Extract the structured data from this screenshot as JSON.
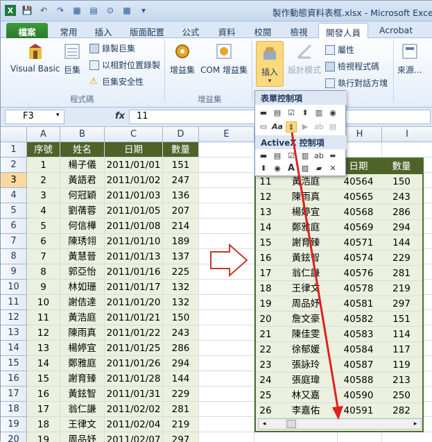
{
  "window": {
    "title": "製作動態資料表框.xlsx - Microsoft Excel"
  },
  "tabs": [
    "檔案",
    "常用",
    "插入",
    "版面配置",
    "公式",
    "資料",
    "校閱",
    "檢視",
    "開發人員",
    "Acrobat"
  ],
  "ribbon": {
    "visual_basic": "Visual Basic",
    "macros": "巨集",
    "record_macro": "錄製巨集",
    "relative_ref": "以相對位置錄製",
    "macro_security": "巨集安全性",
    "group_code": "程式碼",
    "addins": "增益集",
    "com_addins": "COM 增益集",
    "group_addins": "增益集",
    "insert": "插入",
    "design_mode": "設計模式",
    "properties": "屬性",
    "view_code": "檢視程式碼",
    "run_dialog": "執行對話方塊",
    "source": "來源..."
  },
  "popup": {
    "form_controls": "表單控制項",
    "activex_controls": "ActiveX 控制項"
  },
  "namebox": "F3",
  "formula": "11",
  "columns": [
    "A",
    "B",
    "C",
    "D",
    "E",
    "",
    "H",
    "I"
  ],
  "table": {
    "headers": [
      "序號",
      "姓名",
      "日期",
      "數量"
    ],
    "rows": [
      [
        "1",
        "楊子儀",
        "2011/01/01",
        "151"
      ],
      [
        "2",
        "黃語君",
        "2011/01/02",
        "247"
      ],
      [
        "3",
        "何冠穎",
        "2011/01/03",
        "136"
      ],
      [
        "4",
        "劉蒨蓉",
        "2011/01/05",
        "207"
      ],
      [
        "5",
        "何信樺",
        "2011/01/08",
        "214"
      ],
      [
        "6",
        "陳琇翎",
        "2011/01/10",
        "189"
      ],
      [
        "7",
        "黃慧晉",
        "2011/01/13",
        "137"
      ],
      [
        "8",
        "郭亞怡",
        "2011/01/16",
        "225"
      ],
      [
        "9",
        "林如珊",
        "2011/01/17",
        "132"
      ],
      [
        "10",
        "謝佶達",
        "2011/01/20",
        "132"
      ],
      [
        "11",
        "黃浩庭",
        "2011/01/21",
        "150"
      ],
      [
        "12",
        "陳雨真",
        "2011/01/22",
        "243"
      ],
      [
        "13",
        "楊婷宜",
        "2011/01/25",
        "286"
      ],
      [
        "14",
        "鄭雅庭",
        "2011/01/26",
        "294"
      ],
      [
        "15",
        "謝育臻",
        "2011/01/28",
        "144"
      ],
      [
        "16",
        "黃鉉智",
        "2011/01/31",
        "229"
      ],
      [
        "17",
        "翁仁謙",
        "2011/02/02",
        "281"
      ],
      [
        "18",
        "王律文",
        "2011/02/04",
        "219"
      ],
      [
        "19",
        "周品妤",
        "2011/02/07",
        "297"
      ]
    ]
  },
  "form": {
    "headers": [
      "",
      "",
      "日期",
      "數量"
    ],
    "rows": [
      [
        "11",
        "黃浩庭",
        "40564",
        "150"
      ],
      [
        "12",
        "陳雨真",
        "40565",
        "243"
      ],
      [
        "13",
        "楊婷宜",
        "40568",
        "286"
      ],
      [
        "14",
        "鄭雅庭",
        "40569",
        "294"
      ],
      [
        "15",
        "謝育臻",
        "40571",
        "144"
      ],
      [
        "16",
        "黃鉉智",
        "40574",
        "229"
      ],
      [
        "17",
        "翁仁謙",
        "40576",
        "281"
      ],
      [
        "18",
        "王律文",
        "40578",
        "219"
      ],
      [
        "19",
        "周品妤",
        "40581",
        "297"
      ],
      [
        "20",
        "詹文豪",
        "40582",
        "151"
      ],
      [
        "21",
        "陳佳雯",
        "40583",
        "114"
      ],
      [
        "22",
        "徐郁媛",
        "40584",
        "117"
      ],
      [
        "23",
        "張詠玲",
        "40587",
        "119"
      ],
      [
        "24",
        "張庭瑋",
        "40588",
        "213"
      ],
      [
        "25",
        "林又嘉",
        "40590",
        "250"
      ],
      [
        "26",
        "李嘉佑",
        "40591",
        "282"
      ]
    ]
  },
  "colors": {
    "header_green": "#4f6228",
    "body_green": "#ebf1de",
    "arrow_red": "#e0201b"
  }
}
